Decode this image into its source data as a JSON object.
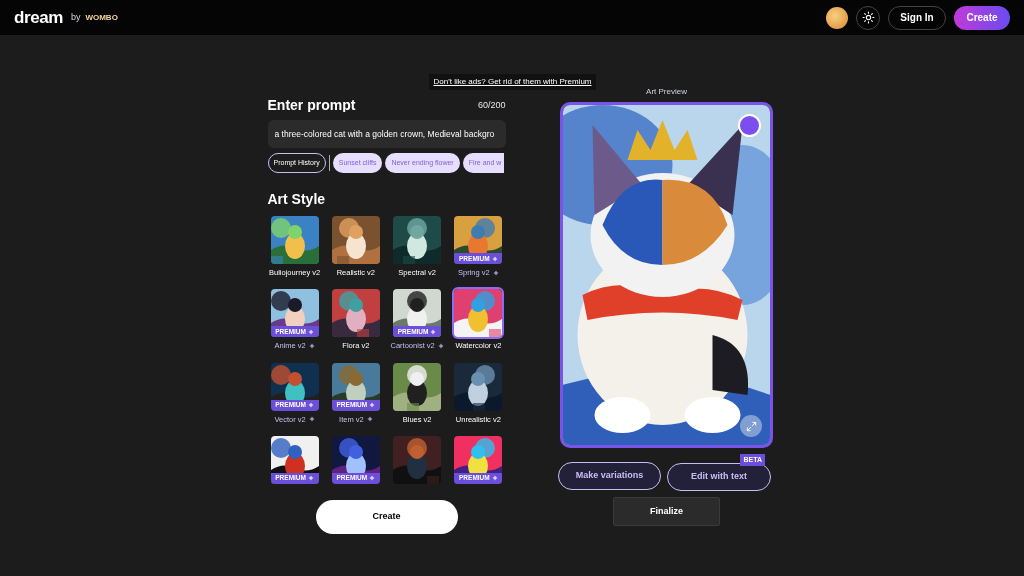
{
  "header": {
    "logo": "dream",
    "by": "by",
    "brand": "WOMBO",
    "sign_in": "Sign In",
    "create": "Create"
  },
  "ad_link": "Don't like ads? Get rid of them with Premium",
  "prompt": {
    "title": "Enter prompt",
    "count": "60/200",
    "value": "a three-colored cat with a golden crown, Medieval backgro",
    "history": "Prompt History",
    "suggestions": [
      "Sunset cliffs",
      "Never ending flower",
      "Fire and w"
    ]
  },
  "art_style": {
    "title": "Art Style",
    "styles": [
      {
        "label": "Buliojourney v2",
        "selected": false
      },
      {
        "label": "Realistic v2",
        "selected": false
      },
      {
        "label": "Spectral v2",
        "selected": false
      },
      {
        "label": "Spring v2",
        "badge": "PREMIUM",
        "selected": false
      },
      {
        "label": "Anime v2",
        "badge": "PREMIUM",
        "selected": false
      },
      {
        "label": "Flora v2",
        "selected": false
      },
      {
        "label": "Cartoonist v2",
        "badge": "PREMIUM",
        "selected": false
      },
      {
        "label": "Watercolor v2",
        "selected": true
      },
      {
        "label": "Vector v2",
        "badge": "PREMIUM",
        "selected": false
      },
      {
        "label": "Item v2",
        "badge": "PREMIUM",
        "selected": false
      },
      {
        "label": "Blues v2",
        "selected": false
      },
      {
        "label": "Unrealistic v2",
        "selected": false
      },
      {
        "badge": "PREMIUM",
        "selected": false
      },
      {
        "badge": "PREMIUM",
        "selected": false
      },
      {
        "selected": false
      },
      {
        "badge": "PREMIUM",
        "selected": false
      }
    ]
  },
  "create_button": "Create",
  "preview": {
    "title": "Art Preview",
    "make_variations": "Make variations",
    "edit_with_text": "Edit with text",
    "beta": "BETA",
    "finalize": "Finalize"
  }
}
